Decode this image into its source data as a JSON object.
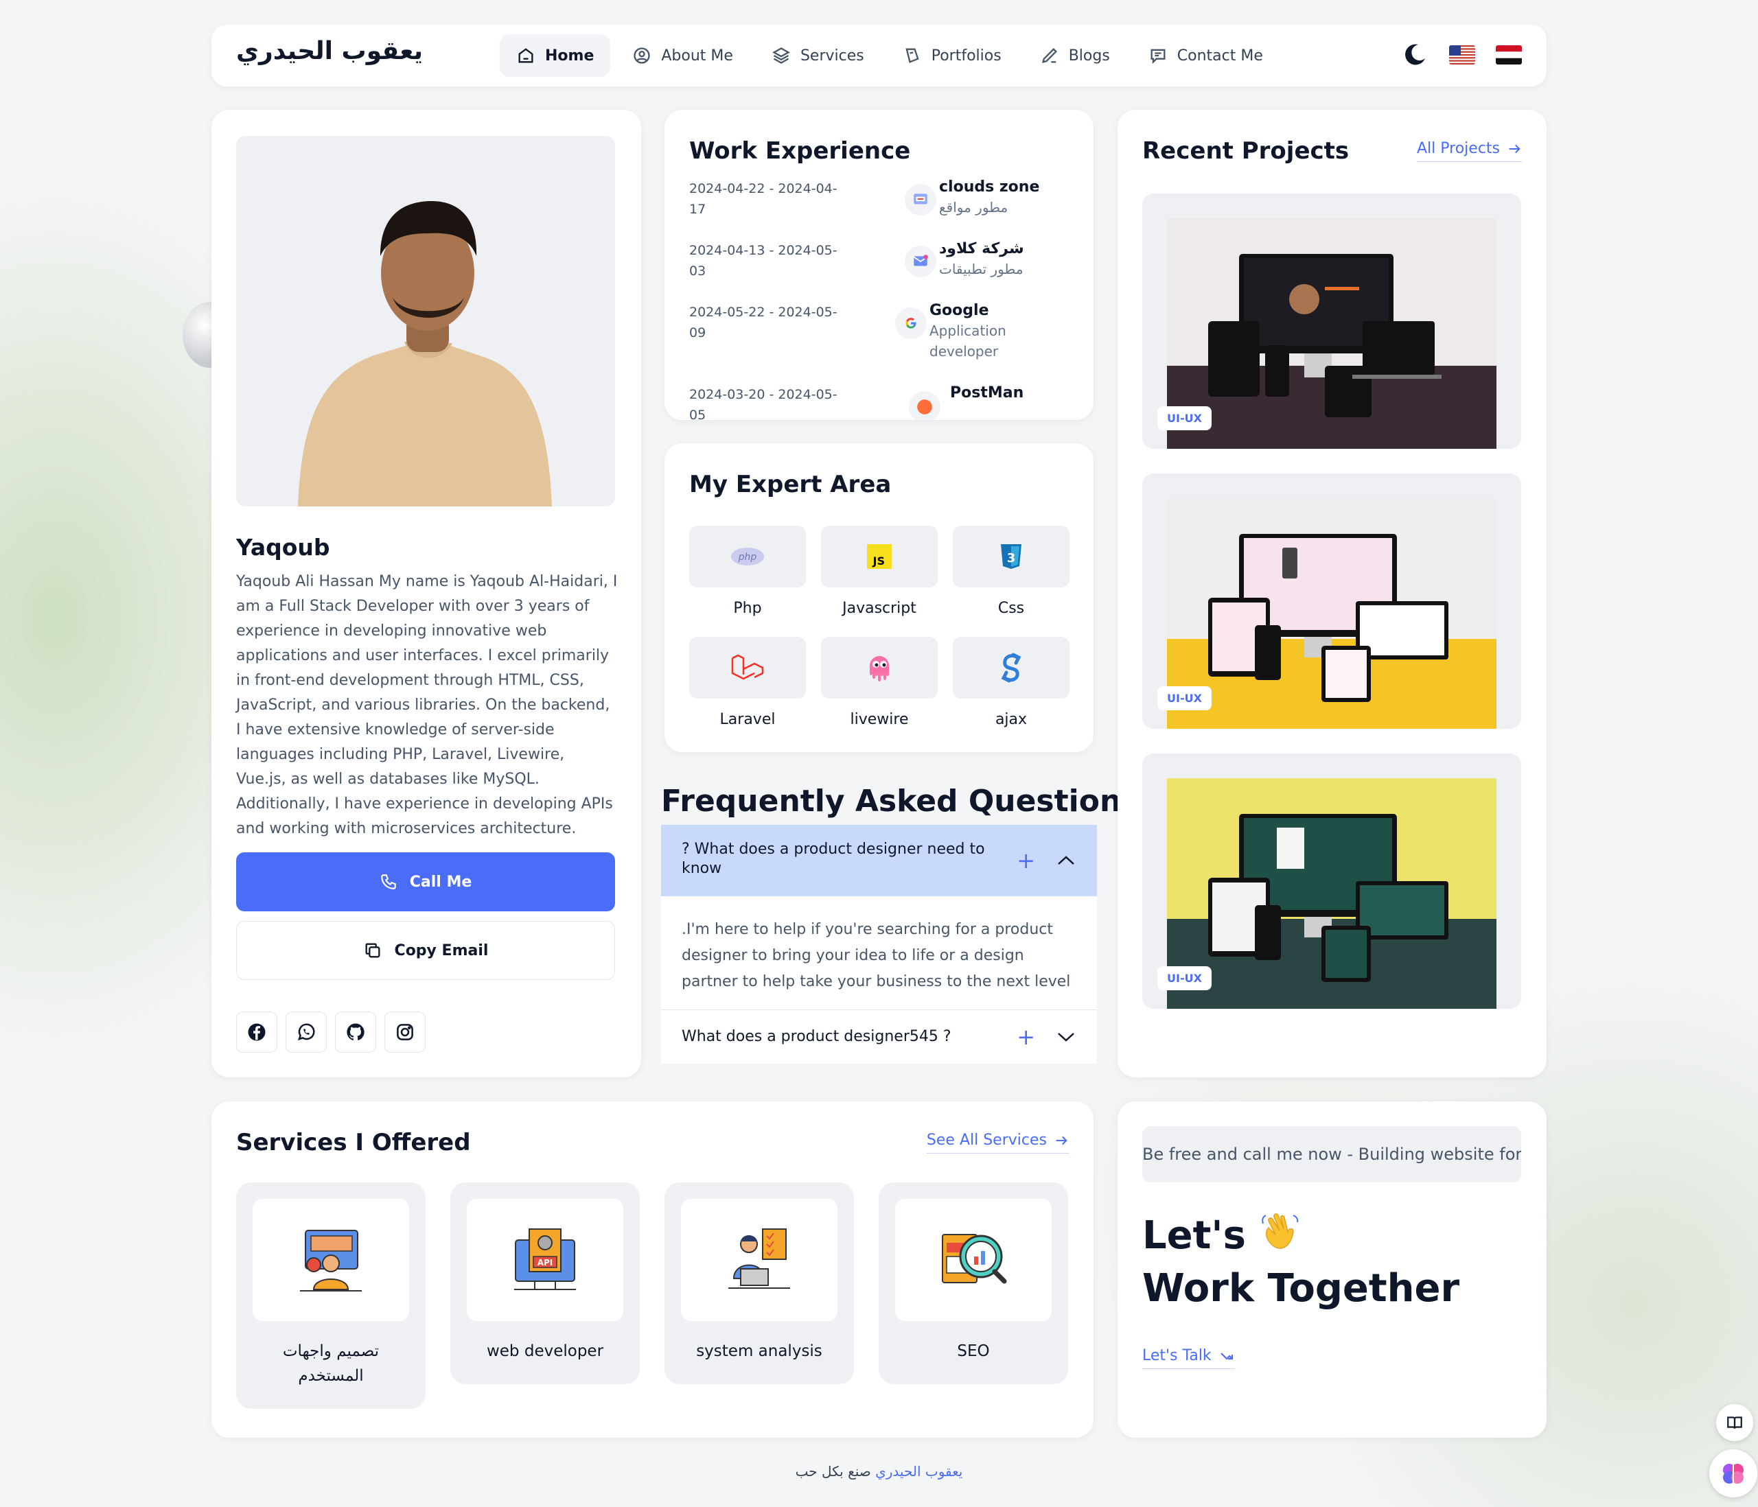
{
  "header": {
    "brand": "يعقوب الحيدري",
    "nav": [
      {
        "label": "Home",
        "icon": "home-icon",
        "active": true
      },
      {
        "label": "About Me",
        "icon": "user-icon"
      },
      {
        "label": "Services",
        "icon": "layers-icon"
      },
      {
        "label": "Portfolios",
        "icon": "portfolio-icon"
      },
      {
        "label": "Blogs",
        "icon": "pen-icon"
      },
      {
        "label": "Contact Me",
        "icon": "chat-icon"
      }
    ],
    "theme_icon": "moon-icon",
    "languages": [
      "English",
      "Arabic"
    ]
  },
  "profile": {
    "name": "Yaqoub",
    "bio": "Yaqoub Ali Hassan My name is Yaqoub Al-Haidari, I am a Full Stack Developer with over 3 years of experience in developing innovative web applications and user interfaces. I excel primarily in front-end development through HTML, CSS, JavaScript, and various libraries. On the backend, I have extensive knowledge of server-side languages including PHP, Laravel, Livewire, Vue.js, as well as databases like MySQL. Additionally, I have experience in developing APIs and working with microservices architecture.",
    "call_label": "Call Me",
    "copy_label": "Copy Email",
    "socials": [
      "facebook-icon",
      "whatsapp-icon",
      "github-icon",
      "instagram-icon"
    ]
  },
  "work": {
    "title": "Work Experience",
    "items": [
      {
        "dates": "2024-04-22 - 2024-04-17",
        "company": "clouds zone",
        "role": "مطور مواقع"
      },
      {
        "dates": "2024-04-13 - 2024-05-03",
        "company": "شركة كلاود",
        "role": "مطور تطبيقات"
      },
      {
        "dates": "2024-05-22 - 2024-05-09",
        "company": "Google",
        "role": "Application developer"
      },
      {
        "dates": "2024-03-20 - 2024-05-05",
        "company": "PostMan",
        "role": ""
      }
    ]
  },
  "expert": {
    "title": "My Expert Area",
    "skills": [
      "Php",
      "Javascript",
      "Css",
      "Laravel",
      "livewire",
      "ajax"
    ]
  },
  "faq": {
    "title": "Frequently Asked Questions",
    "items": [
      {
        "q": "? What does a product designer need to know",
        "a": ".I'm here to help if you're searching for a product designer to bring your idea to life or a design partner to help take your business to the next level",
        "open": true
      },
      {
        "q": "What does a product designer545 ?",
        "open": false
      }
    ]
  },
  "projects": {
    "title": "Recent Projects",
    "all_label": "All Projects",
    "items": [
      {
        "badge": "UI-UX"
      },
      {
        "badge": "UI-UX"
      },
      {
        "badge": "UI-UX"
      }
    ]
  },
  "services": {
    "title": "Services I Offered",
    "all_label": "See All Services",
    "items": [
      "تصميم واجهات المستخدم",
      "web developer",
      "system analysis",
      "SEO"
    ]
  },
  "together": {
    "marquee": "Be free and call me now - Building website for you",
    "line1": "Let's",
    "line2": "Work Together",
    "talk_label": "Let's Talk"
  },
  "footer": {
    "name": "يعقوب الحيدري",
    "text": "صنع بكل حب"
  },
  "colors": {
    "accent": "#4a6cf7",
    "faq_open_bg": "#c9d9fb",
    "card_bg": "#ffffff",
    "tile_bg": "#eef0f3"
  }
}
